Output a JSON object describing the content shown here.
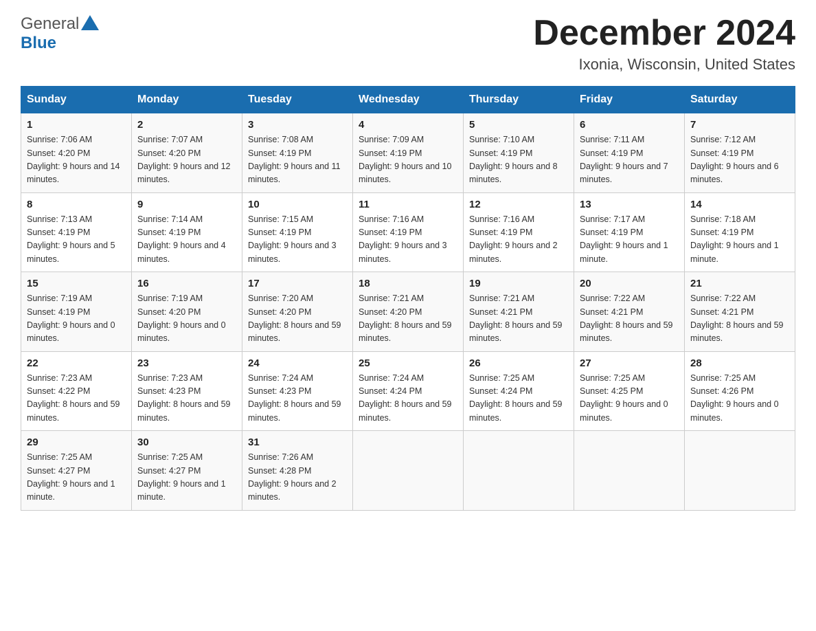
{
  "header": {
    "logo_general": "General",
    "logo_blue": "Blue",
    "title": "December 2024",
    "subtitle": "Ixonia, Wisconsin, United States"
  },
  "columns": [
    "Sunday",
    "Monday",
    "Tuesday",
    "Wednesday",
    "Thursday",
    "Friday",
    "Saturday"
  ],
  "weeks": [
    [
      {
        "day": "1",
        "sunrise": "7:06 AM",
        "sunset": "4:20 PM",
        "daylight": "9 hours and 14 minutes."
      },
      {
        "day": "2",
        "sunrise": "7:07 AM",
        "sunset": "4:20 PM",
        "daylight": "9 hours and 12 minutes."
      },
      {
        "day": "3",
        "sunrise": "7:08 AM",
        "sunset": "4:19 PM",
        "daylight": "9 hours and 11 minutes."
      },
      {
        "day": "4",
        "sunrise": "7:09 AM",
        "sunset": "4:19 PM",
        "daylight": "9 hours and 10 minutes."
      },
      {
        "day": "5",
        "sunrise": "7:10 AM",
        "sunset": "4:19 PM",
        "daylight": "9 hours and 8 minutes."
      },
      {
        "day": "6",
        "sunrise": "7:11 AM",
        "sunset": "4:19 PM",
        "daylight": "9 hours and 7 minutes."
      },
      {
        "day": "7",
        "sunrise": "7:12 AM",
        "sunset": "4:19 PM",
        "daylight": "9 hours and 6 minutes."
      }
    ],
    [
      {
        "day": "8",
        "sunrise": "7:13 AM",
        "sunset": "4:19 PM",
        "daylight": "9 hours and 5 minutes."
      },
      {
        "day": "9",
        "sunrise": "7:14 AM",
        "sunset": "4:19 PM",
        "daylight": "9 hours and 4 minutes."
      },
      {
        "day": "10",
        "sunrise": "7:15 AM",
        "sunset": "4:19 PM",
        "daylight": "9 hours and 3 minutes."
      },
      {
        "day": "11",
        "sunrise": "7:16 AM",
        "sunset": "4:19 PM",
        "daylight": "9 hours and 3 minutes."
      },
      {
        "day": "12",
        "sunrise": "7:16 AM",
        "sunset": "4:19 PM",
        "daylight": "9 hours and 2 minutes."
      },
      {
        "day": "13",
        "sunrise": "7:17 AM",
        "sunset": "4:19 PM",
        "daylight": "9 hours and 1 minute."
      },
      {
        "day": "14",
        "sunrise": "7:18 AM",
        "sunset": "4:19 PM",
        "daylight": "9 hours and 1 minute."
      }
    ],
    [
      {
        "day": "15",
        "sunrise": "7:19 AM",
        "sunset": "4:19 PM",
        "daylight": "9 hours and 0 minutes."
      },
      {
        "day": "16",
        "sunrise": "7:19 AM",
        "sunset": "4:20 PM",
        "daylight": "9 hours and 0 minutes."
      },
      {
        "day": "17",
        "sunrise": "7:20 AM",
        "sunset": "4:20 PM",
        "daylight": "8 hours and 59 minutes."
      },
      {
        "day": "18",
        "sunrise": "7:21 AM",
        "sunset": "4:20 PM",
        "daylight": "8 hours and 59 minutes."
      },
      {
        "day": "19",
        "sunrise": "7:21 AM",
        "sunset": "4:21 PM",
        "daylight": "8 hours and 59 minutes."
      },
      {
        "day": "20",
        "sunrise": "7:22 AM",
        "sunset": "4:21 PM",
        "daylight": "8 hours and 59 minutes."
      },
      {
        "day": "21",
        "sunrise": "7:22 AM",
        "sunset": "4:21 PM",
        "daylight": "8 hours and 59 minutes."
      }
    ],
    [
      {
        "day": "22",
        "sunrise": "7:23 AM",
        "sunset": "4:22 PM",
        "daylight": "8 hours and 59 minutes."
      },
      {
        "day": "23",
        "sunrise": "7:23 AM",
        "sunset": "4:23 PM",
        "daylight": "8 hours and 59 minutes."
      },
      {
        "day": "24",
        "sunrise": "7:24 AM",
        "sunset": "4:23 PM",
        "daylight": "8 hours and 59 minutes."
      },
      {
        "day": "25",
        "sunrise": "7:24 AM",
        "sunset": "4:24 PM",
        "daylight": "8 hours and 59 minutes."
      },
      {
        "day": "26",
        "sunrise": "7:25 AM",
        "sunset": "4:24 PM",
        "daylight": "8 hours and 59 minutes."
      },
      {
        "day": "27",
        "sunrise": "7:25 AM",
        "sunset": "4:25 PM",
        "daylight": "9 hours and 0 minutes."
      },
      {
        "day": "28",
        "sunrise": "7:25 AM",
        "sunset": "4:26 PM",
        "daylight": "9 hours and 0 minutes."
      }
    ],
    [
      {
        "day": "29",
        "sunrise": "7:25 AM",
        "sunset": "4:27 PM",
        "daylight": "9 hours and 1 minute."
      },
      {
        "day": "30",
        "sunrise": "7:25 AM",
        "sunset": "4:27 PM",
        "daylight": "9 hours and 1 minute."
      },
      {
        "day": "31",
        "sunrise": "7:26 AM",
        "sunset": "4:28 PM",
        "daylight": "9 hours and 2 minutes."
      },
      null,
      null,
      null,
      null
    ]
  ],
  "labels": {
    "sunrise_prefix": "Sunrise: ",
    "sunset_prefix": "Sunset: ",
    "daylight_prefix": "Daylight: "
  }
}
